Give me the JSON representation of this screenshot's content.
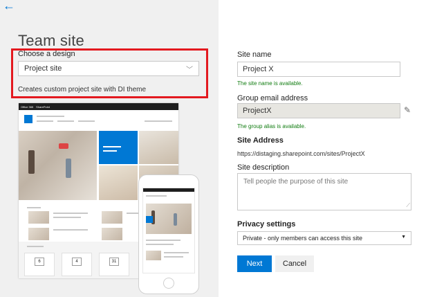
{
  "nav": {
    "back_icon": "←"
  },
  "left": {
    "title": "Team site",
    "choose_label": "Choose a design",
    "design_selected": "Project site",
    "design_description": "Creates custom project site with DI theme",
    "preview": {
      "top_bar_app": "Office 365",
      "top_bar_product": "SharePoint",
      "calendar_dates": [
        "6",
        "4",
        "31"
      ]
    }
  },
  "form": {
    "site_name_label": "Site name",
    "site_name_value": "Project X",
    "site_name_status": "The site name is available.",
    "group_email_label": "Group email address",
    "group_email_value": "ProjectX",
    "group_email_status": "The group alias is available.",
    "site_address_label": "Site Address",
    "site_address_value": "https://distaging.sharepoint.com/sites/ProjectX",
    "site_description_label": "Site description",
    "site_description_placeholder": "Tell people the purpose of this site",
    "privacy_label": "Privacy settings",
    "privacy_value": "Private - only members can access this site",
    "next_label": "Next",
    "cancel_label": "Cancel"
  },
  "colors": {
    "accent": "#0078d4",
    "highlight": "#e3191f",
    "success": "#107c10"
  }
}
